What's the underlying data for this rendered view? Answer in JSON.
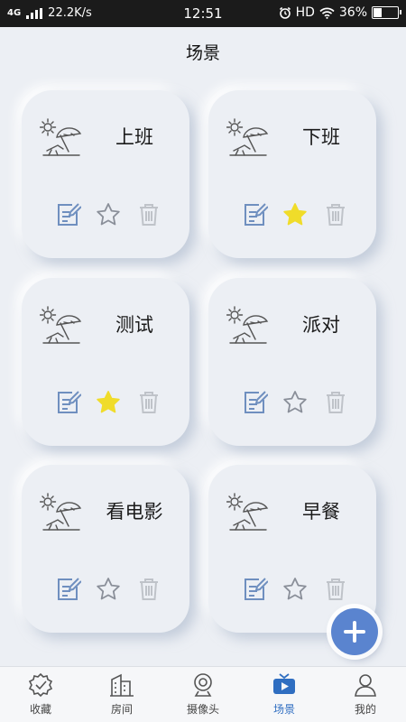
{
  "status_bar": {
    "network": "4G",
    "speed": "22.2K/s",
    "time": "12:51",
    "hd": "HD",
    "battery": "36%",
    "battery_level": 0.36
  },
  "header": {
    "title": "场景"
  },
  "scenes": [
    {
      "name": "上班",
      "favorite": false,
      "icon": "beach-umbrella-icon"
    },
    {
      "name": "下班",
      "favorite": true,
      "icon": "beach-umbrella-icon"
    },
    {
      "name": "测试",
      "favorite": true,
      "icon": "beach-umbrella-icon"
    },
    {
      "name": "派对",
      "favorite": false,
      "icon": "beach-umbrella-icon"
    },
    {
      "name": "看电影",
      "favorite": false,
      "icon": "beach-umbrella-icon"
    },
    {
      "name": "早餐",
      "favorite": false,
      "icon": "beach-umbrella-icon"
    }
  ],
  "colors": {
    "edit": "#6f8fbf",
    "star_on": "#f0dc2a",
    "star_off": "#8a8f99",
    "trash": "#bfc3c9",
    "accent": "#5a84cf",
    "tab_active": "#2f6ec1"
  },
  "tabs": [
    {
      "label": "收藏",
      "icon": "badge-check-icon",
      "active": false
    },
    {
      "label": "房间",
      "icon": "building-icon",
      "active": false
    },
    {
      "label": "摄像头",
      "icon": "camera-icon",
      "active": false
    },
    {
      "label": "场景",
      "icon": "tv-play-icon",
      "active": true
    },
    {
      "label": "我的",
      "icon": "person-icon",
      "active": false
    }
  ]
}
